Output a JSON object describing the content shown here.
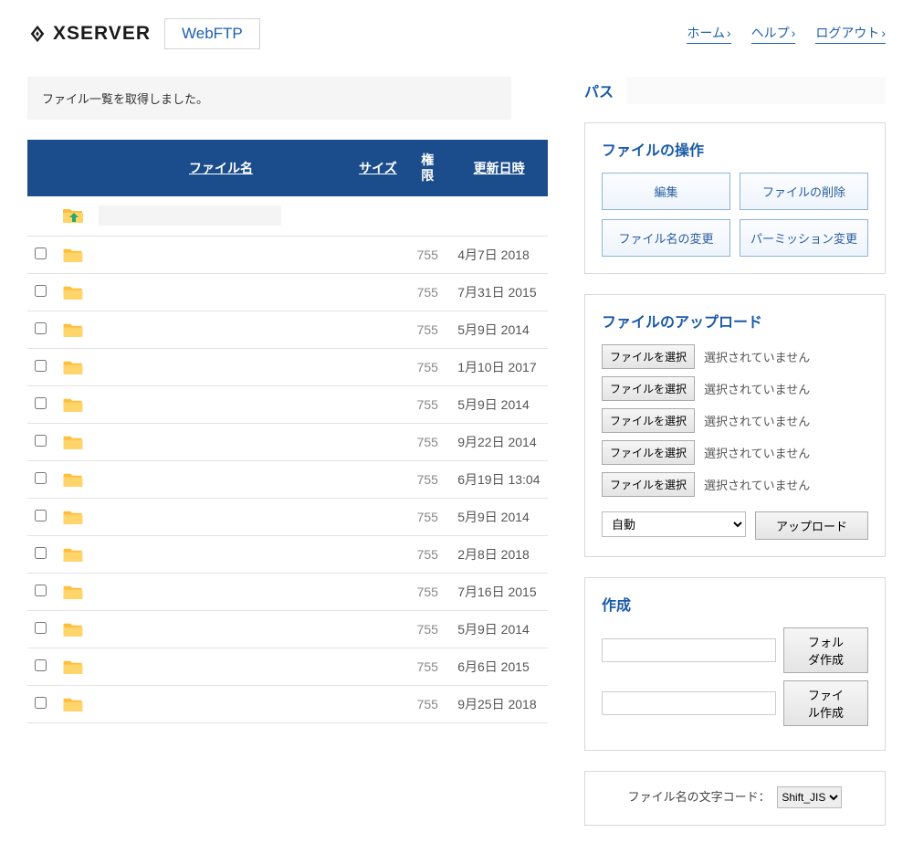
{
  "header": {
    "brand": "XSERVER",
    "subtitle": "WebFTP",
    "links": {
      "home": "ホーム",
      "help": "ヘルプ",
      "logout": "ログアウト"
    }
  },
  "message": "ファイル一覧を取得しました。",
  "table": {
    "headers": {
      "filename": "ファイル名",
      "size": "サイズ",
      "perm": "権\n限",
      "date": "更新日時"
    },
    "rows": [
      {
        "type": "up",
        "perm": "",
        "date": ""
      },
      {
        "type": "folder",
        "perm": "755",
        "date": "4月7日 2018"
      },
      {
        "type": "folder",
        "perm": "755",
        "date": "7月31日 2015"
      },
      {
        "type": "folder",
        "perm": "755",
        "date": "5月9日 2014"
      },
      {
        "type": "folder",
        "perm": "755",
        "date": "1月10日 2017"
      },
      {
        "type": "folder",
        "perm": "755",
        "date": "5月9日 2014"
      },
      {
        "type": "folder",
        "perm": "755",
        "date": "9月22日 2014"
      },
      {
        "type": "folder",
        "perm": "755",
        "date": "6月19日 13:04"
      },
      {
        "type": "folder",
        "perm": "755",
        "date": "5月9日 2014"
      },
      {
        "type": "folder",
        "perm": "755",
        "date": "2月8日 2018"
      },
      {
        "type": "folder",
        "perm": "755",
        "date": "7月16日 2015"
      },
      {
        "type": "folder",
        "perm": "755",
        "date": "5月9日 2014"
      },
      {
        "type": "folder",
        "perm": "755",
        "date": "6月6日 2015"
      },
      {
        "type": "folder",
        "perm": "755",
        "date": "9月25日 2018"
      }
    ]
  },
  "path_label": "パス",
  "ops": {
    "title": "ファイルの操作",
    "edit": "編集",
    "delete": "ファイルの削除",
    "rename": "ファイル名の変更",
    "chmod": "パーミッション変更"
  },
  "upload": {
    "title": "ファイルのアップロード",
    "choose": "ファイルを選択",
    "none": "選択されていません",
    "auto": "自動",
    "submit": "アップロード"
  },
  "create": {
    "title": "作成",
    "mkdir": "フォルダ作成",
    "mkfile": "ファイル作成"
  },
  "encoding": {
    "label": "ファイル名の文字コード：",
    "value": "Shift_JIS"
  }
}
